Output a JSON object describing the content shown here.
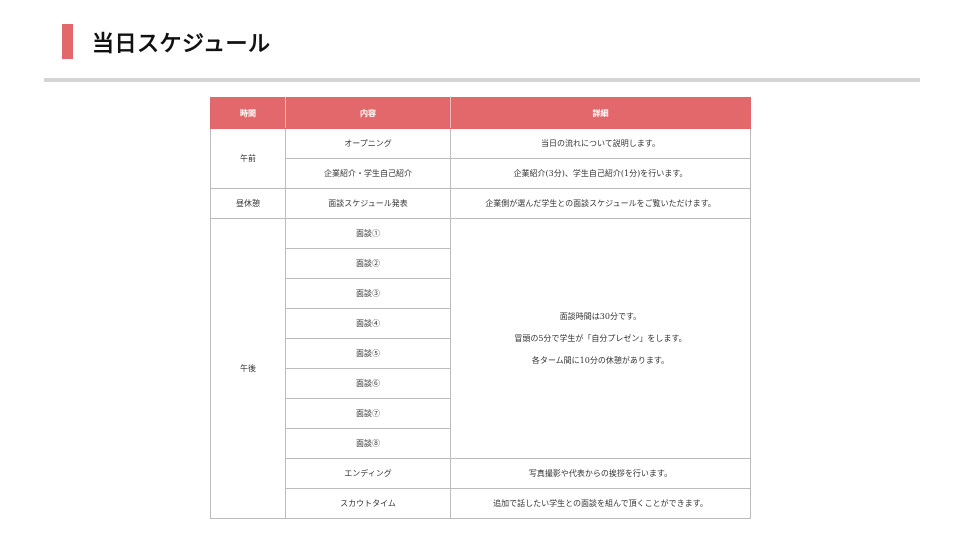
{
  "page": {
    "title": "当日スケジュール",
    "accent_color": "#e2686b"
  },
  "table": {
    "headers": {
      "time": "時間",
      "content": "内容",
      "detail": "詳細"
    },
    "morning": {
      "time": "午前",
      "rows": [
        {
          "content": "オープニング",
          "detail": "当日の流れについて説明します。"
        },
        {
          "content": "企業紹介・学生自己紹介",
          "detail": "企業紹介(3分)、学生自己紹介(1分)を行います。"
        }
      ]
    },
    "lunch": {
      "time": "昼休憩",
      "content": "面談スケジュール発表",
      "detail": "企業側が選んだ学生との面談スケジュールをご覧いただけます。"
    },
    "afternoon": {
      "time": "午後",
      "interviews": [
        "面談①",
        "面談②",
        "面談③",
        "面談④",
        "面談⑤",
        "面談⑥",
        "面談⑦",
        "面談⑧"
      ],
      "interview_detail": [
        "面談時間は30分です。",
        "冒頭の5分で学生が「自分プレゼン」をします。",
        "各ターム間に10分の休憩があります。"
      ],
      "rows": [
        {
          "content": "エンディング",
          "detail": "写真撮影や代表からの挨拶を行います。"
        },
        {
          "content": "スカウトタイム",
          "detail": "追加で話したい学生との面談を組んで頂くことができます。"
        }
      ]
    }
  }
}
